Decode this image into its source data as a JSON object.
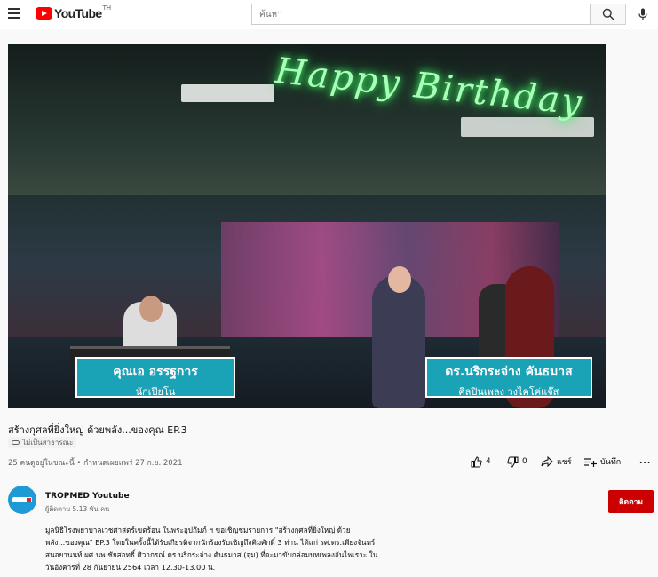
{
  "header": {
    "logo_text": "YouTube",
    "logo_country": "TH",
    "search_placeholder": "ค้นหา",
    "brand_color": "#ff0000"
  },
  "video": {
    "neon_sign": "Happy Birthday",
    "caption_left": {
      "name": "คุณเอ อรรฐการ",
      "role": "นักเปียโน"
    },
    "caption_right": {
      "name": "ดร.นริกระจ่าง คันธมาส",
      "role": "ศิลปินเพลง วงไคโค่แจ๊ส"
    },
    "title": "สร้างกุศลที่ยิ่งใหญ่ ด้วยพลัง...ของคุณ EP.3",
    "visibility": "ไม่เป็นสาธารณะ",
    "meta": "25 คนดูอยู่ในขณะนี้ • กำหนดเผยแพร่ 27 ก.ย. 2021"
  },
  "actions": {
    "like_count": "4",
    "dislike_count": "0",
    "share_label": "แชร์",
    "save_label": "บันทึก",
    "more_label": "..."
  },
  "channel": {
    "name": "TROPMED Youtube",
    "subscribers": "ผู้ติดตาม 5.13 พัน คน",
    "subscribe_label": "ติดตาม",
    "subscribe_color": "#cc0000"
  },
  "description": {
    "lines": [
      "มูลนิธิโรงพยาบาลเวชศาสตร์เขตร้อน ในพระอุปถัมภ์ ฯ ขอเชิญชมรายการ \"สร้างกุศลที่ยิ่งใหญ่ ด้วย",
      "พลัง...ของคุณ\" EP.3 โดยในครั้งนี้ได้รับเกียรติจากนักร้องรับเชิญถึงคิมศักดิ์ 3 ท่าน ได้แก่ รศ.ดร.เพียงจันทร์",
      "สนอยานนท์ ผศ.นพ.ชัยสอทธิ์ ศิวากรณ์ ดร.นริกระจ่าง คันธมาส (จุ่ม) ที่จะมาขับกล่อมบทเพลงอันไพเราะ ใน",
      "วันอังคารที่ 28 กันยายน 2564 เวลา 12.30-13.00 น."
    ]
  }
}
